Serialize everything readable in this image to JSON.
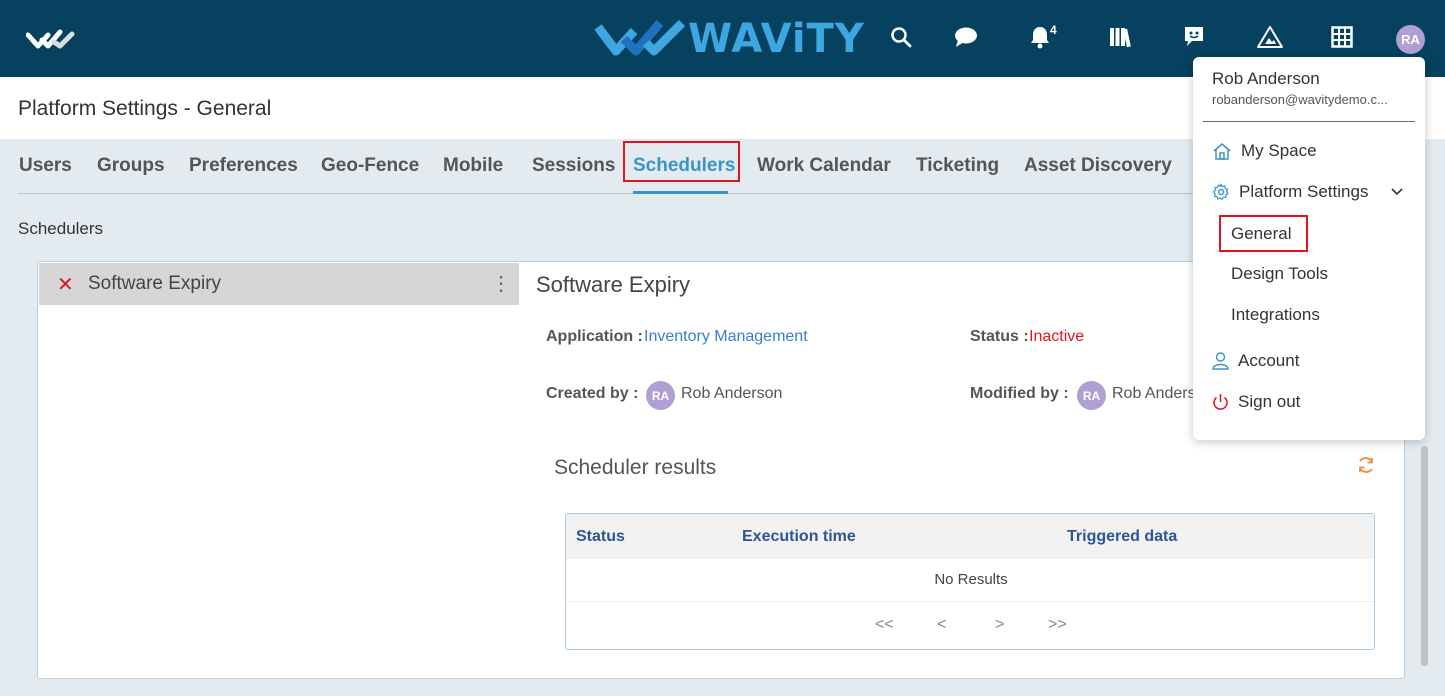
{
  "brand": {
    "name": "WAViTY"
  },
  "topbar": {
    "notifications_count": "4",
    "user_initials": "RA",
    "icons": [
      "search-icon",
      "chat-icon",
      "bell-icon",
      "library-icon",
      "feedback-icon",
      "alert-triangle-icon",
      "grid-icon"
    ]
  },
  "page": {
    "title": "Platform Settings - General"
  },
  "tabs": [
    {
      "label": "Users"
    },
    {
      "label": "Groups"
    },
    {
      "label": "Preferences"
    },
    {
      "label": "Geo-Fence"
    },
    {
      "label": "Mobile"
    },
    {
      "label": "Sessions"
    },
    {
      "label": "Schedulers",
      "active": true
    },
    {
      "label": "Work Calendar"
    },
    {
      "label": "Ticketing"
    },
    {
      "label": "Asset Discovery"
    }
  ],
  "section_label": "Schedulers",
  "scheduler_list": [
    {
      "label": "Software Expiry"
    }
  ],
  "detail": {
    "title": "Software Expiry",
    "application_label": "Application :",
    "application_value": "Inventory Management",
    "status_label": "Status :",
    "status_value": "Inactive",
    "created_by_label": "Created by :",
    "created_by_initials": "RA",
    "created_by_name": "Rob Anderson",
    "modified_by_label": "Modified by :",
    "modified_by_initials": "RA",
    "modified_by_name": "Rob Anders"
  },
  "results": {
    "title": "Scheduler results",
    "columns": [
      "Status",
      "Execution time",
      "Triggered data"
    ],
    "empty_text": "No Results",
    "pager": {
      "first": "<<",
      "prev": "<",
      "next": ">",
      "last": ">>"
    }
  },
  "user_menu": {
    "name": "Rob Anderson",
    "email": "robanderson@wavitydemo.c...",
    "items": {
      "my_space": "My Space",
      "platform_settings": "Platform Settings",
      "general": "General",
      "design_tools": "Design Tools",
      "integrations": "Integrations",
      "account": "Account",
      "sign_out": "Sign out"
    }
  },
  "colors": {
    "topbar": "#06415f",
    "accent": "#3b94c6",
    "highlight": "#e0141e",
    "avatar": "#b09fd3",
    "link": "#3b7ed0"
  }
}
